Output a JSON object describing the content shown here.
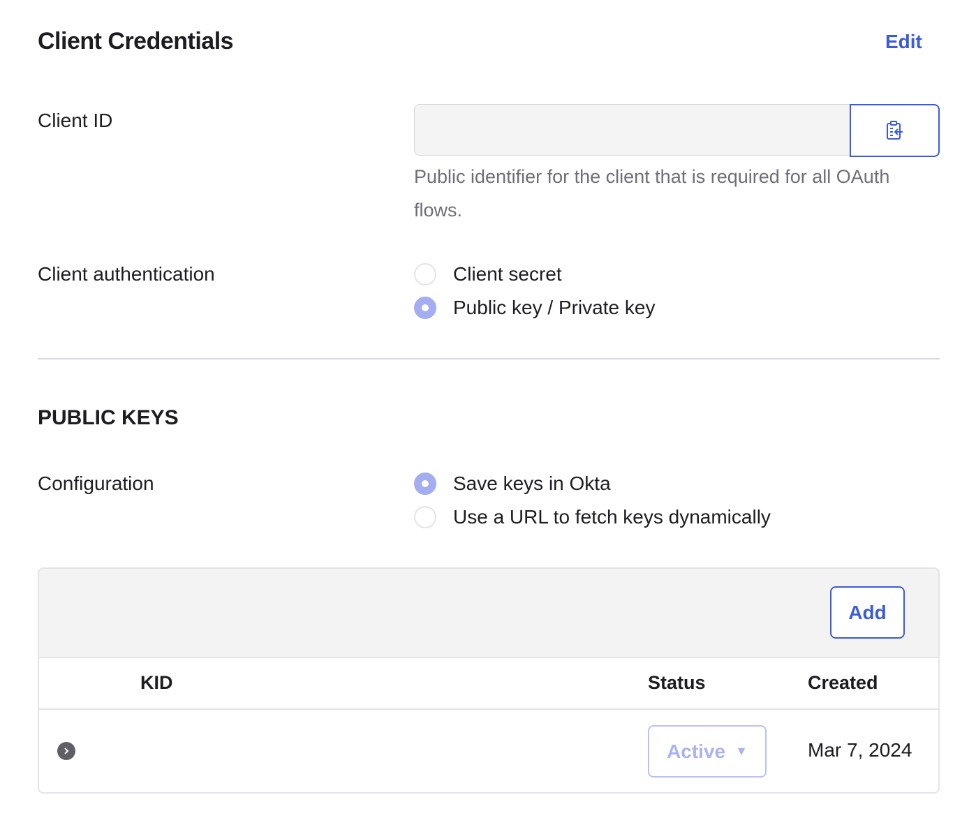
{
  "header": {
    "title": "Client Credentials",
    "edit_label": "Edit"
  },
  "client_id": {
    "label": "Client ID",
    "value": "",
    "hint": "Public identifier for the client that is required for all OAuth flows.",
    "copy_icon": "clipboard-copy-icon"
  },
  "client_auth": {
    "label": "Client authentication",
    "options": [
      {
        "label": "Client secret",
        "checked": false
      },
      {
        "label": "Public key / Private key",
        "checked": true
      }
    ]
  },
  "public_keys": {
    "title": "PUBLIC KEYS",
    "configuration": {
      "label": "Configuration",
      "options": [
        {
          "label": "Save keys in Okta",
          "checked": true
        },
        {
          "label": "Use a URL to fetch keys dynamically",
          "checked": false
        }
      ]
    },
    "table": {
      "add_label": "Add",
      "columns": {
        "kid": "KID",
        "status": "Status",
        "created": "Created"
      },
      "rows": [
        {
          "kid": "",
          "status": "Active",
          "created": "Mar 7, 2024",
          "expand_icon": "chevron-right-icon"
        }
      ]
    }
  },
  "colors": {
    "accent": "#3b5bdb",
    "radio_checked": "#a3adf0",
    "muted_text": "#6e6e78"
  }
}
